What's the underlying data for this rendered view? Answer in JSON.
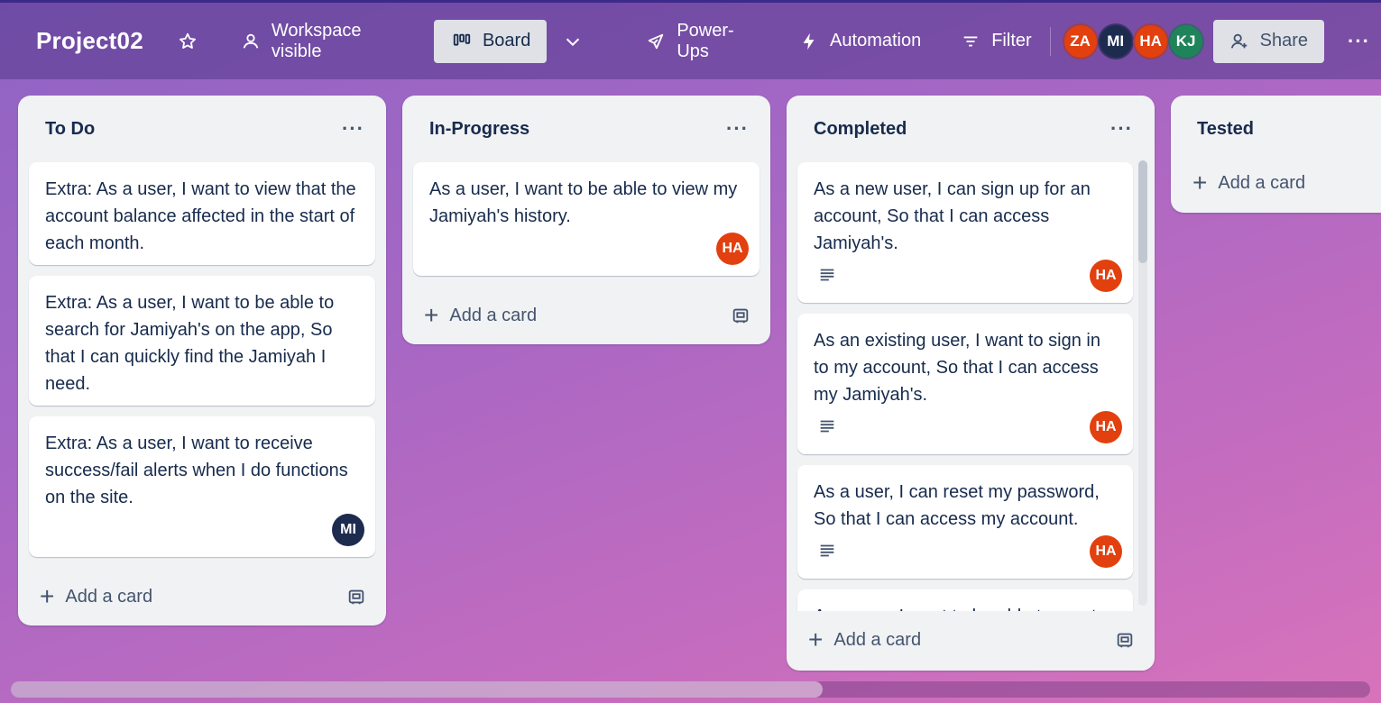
{
  "header": {
    "board_title": "Project02",
    "star_icon": "star-icon",
    "visibility_label": "Workspace visible",
    "view_label": "Board",
    "powerups_label": "Power-Ups",
    "automation_label": "Automation",
    "filter_label": "Filter",
    "share_label": "Share",
    "more_label": "···",
    "members": [
      {
        "initials": "ZA",
        "color": "#e2400e"
      },
      {
        "initials": "MI",
        "color": "#1d2b4f"
      },
      {
        "initials": "HA",
        "color": "#e2400e"
      },
      {
        "initials": "KJ",
        "color": "#1f845a"
      }
    ]
  },
  "lists": [
    {
      "title": "To Do",
      "menu": "···",
      "add_label": "Add a card",
      "cards": [
        {
          "text": "Extra: As a user, I want to view that the account balance affected in the start of each month."
        },
        {
          "text": "Extra: As a user, I want to be able to search for Jamiyah's on the app, So that I can quickly find the Jamiyah I need."
        },
        {
          "text": "Extra: As a user, I want to receive success/fail alerts when I do functions on the site.",
          "member": "MI",
          "member_color": "#1d2b4f"
        }
      ]
    },
    {
      "title": "In-Progress",
      "menu": "···",
      "add_label": "Add a card",
      "cards": [
        {
          "text": "As a user, I want to be able to view my Jamiyah's history.",
          "member": "HA",
          "member_color": "#e2400e"
        }
      ]
    },
    {
      "title": "Completed",
      "menu": "···",
      "add_label": "Add a card",
      "cards": [
        {
          "text": "As a new user, I can sign up for an account, So that I can access Jamiyah's.",
          "member": "HA",
          "member_color": "#e2400e",
          "has_description": true
        },
        {
          "text": "As an existing user, I want to sign in to my account, So that I can access my Jamiyah's.",
          "member": "HA",
          "member_color": "#e2400e",
          "has_description": true
        },
        {
          "text": "As a user, I can reset my password, So that I can access my account.",
          "member": "HA",
          "member_color": "#e2400e",
          "has_description": true
        },
        {
          "text": "As a user, I want to be able to create"
        }
      ]
    },
    {
      "title": "Tested",
      "add_label": "Add a card",
      "cards": []
    }
  ]
}
